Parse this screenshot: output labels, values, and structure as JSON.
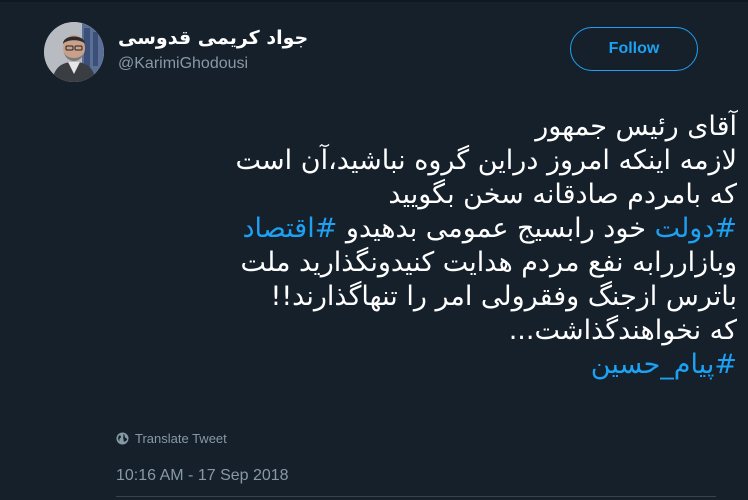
{
  "user": {
    "display_name": "جواد کریمی قدوسی",
    "handle": "@KarimiGhodousi"
  },
  "follow_button": {
    "label": "Follow"
  },
  "tweet": {
    "line1": "آقای رئیس جمهور",
    "line2": "لازمه اینکه امروز دراین گروه نباشید،آن است",
    "line3": "که بامردم صادقانه سخن بگویید",
    "line4_hashtag_1": "#دولت",
    "line4_text": " خود رابسیج عمومی بدهیدو ",
    "line4_hashtag_2": "#اقتصاد",
    "line5": "وبازاررابه نفع مردم هدایت کنیدونگذارید ملت",
    "line6": "باترس ازجنگ وفقرولی امر را تنهاگذارند!!",
    "line7": "که نخواهندگذاشت...",
    "line8_hashtag": "#پیام_حسین"
  },
  "translate": {
    "label": "Translate Tweet",
    "icon": "globe-icon"
  },
  "timestamp": "10:16 AM - 17 Sep 2018",
  "colors": {
    "background": "#15202b",
    "accent": "#1da1f2",
    "secondary_text": "#8899a6",
    "primary_text": "#ffffff"
  }
}
